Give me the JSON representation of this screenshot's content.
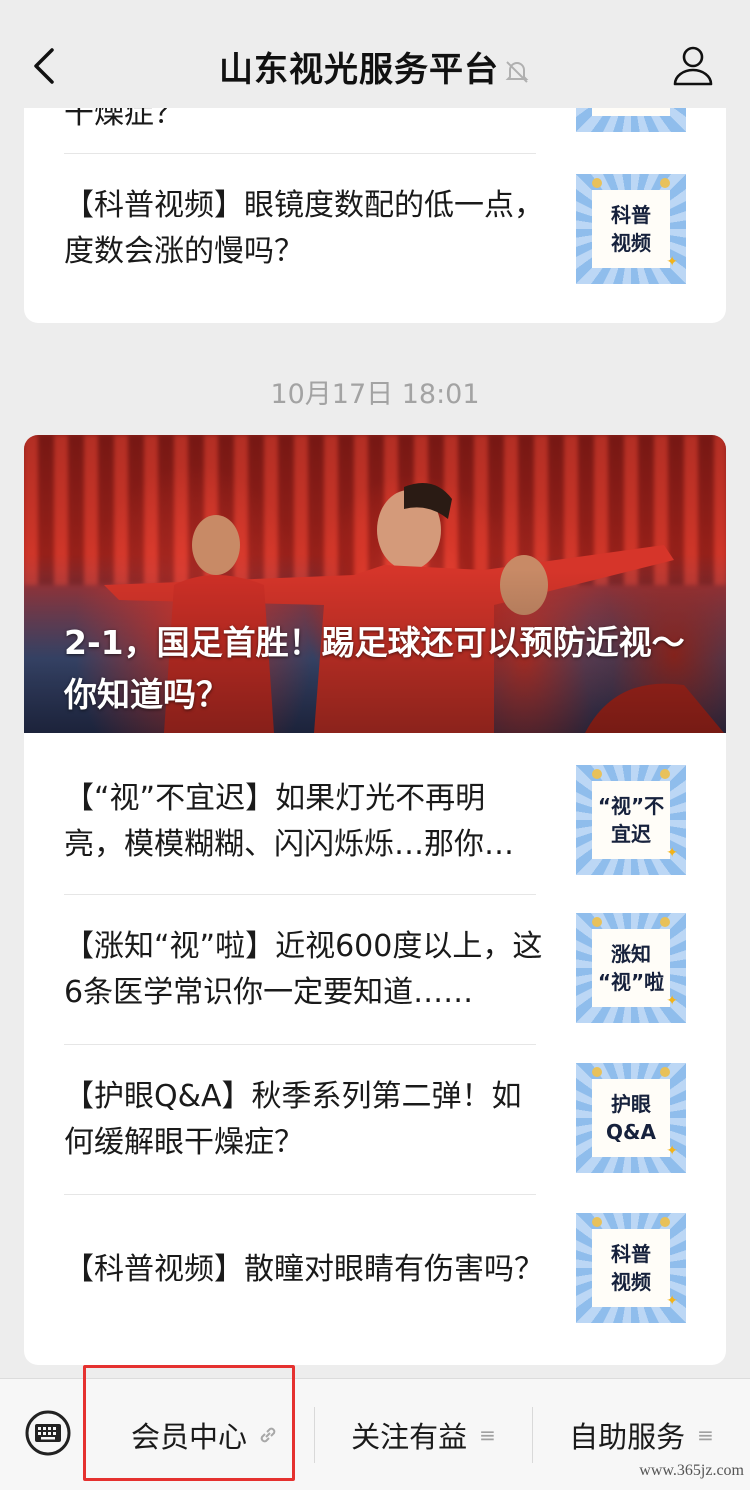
{
  "nav": {
    "title": "山东视光服务平台"
  },
  "card1": {
    "partial_title": "干燥症？",
    "items": [
      {
        "title": "【科普视频】眼镜度数配的低一点，度数会涨的慢吗？",
        "thumb_line1": "科普",
        "thumb_line2": "视频"
      }
    ]
  },
  "timestamp": "10月17日 18:01",
  "card2": {
    "hero_title": "2-1，国足首胜！踢足球还可以预防近视～你知道吗？",
    "items": [
      {
        "title": "【“视”不宜迟】如果灯光不再明亮，模模糊糊、闪闪烁烁…那你…",
        "thumb_line1": "“视”不",
        "thumb_line2": "宜迟"
      },
      {
        "title": "【涨知“视”啦】近视600度以上，这6条医学常识你一定要知道……",
        "thumb_line1": "涨知",
        "thumb_line2": "“视”啦"
      },
      {
        "title": "【护眼Q&A】秋季系列第二弹！如何缓解眼干燥症？",
        "thumb_line1": "护眼",
        "thumb_line2": "Q&A"
      },
      {
        "title": "【科普视频】散瞳对眼睛有伤害吗？",
        "thumb_line1": "科普",
        "thumb_line2": "视频"
      }
    ]
  },
  "menu": {
    "items": [
      {
        "label": "会员中心",
        "icon": "link-icon"
      },
      {
        "label": "关注有益",
        "icon": "menu-lines-icon"
      },
      {
        "label": "自助服务",
        "icon": "menu-lines-icon"
      }
    ]
  },
  "watermark": "www.365jz.com",
  "colors": {
    "background": "#ededed",
    "highlight_box": "#e5312f",
    "thumb_blue": "#8fbdec"
  }
}
